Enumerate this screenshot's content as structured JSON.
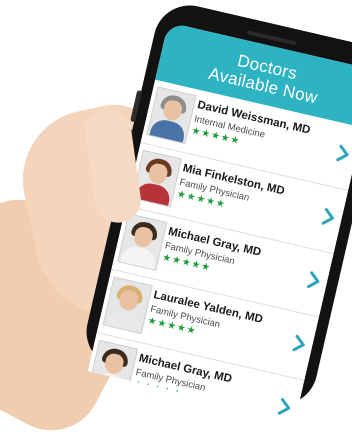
{
  "header": {
    "title_line1": "Doctors",
    "title_line2": "Available Now"
  },
  "doctors": [
    {
      "name": "David Weissman, MD",
      "specialty": "Internal Medicine",
      "stars": "★★★★★",
      "hair": "#8d8d8d",
      "shirt": "#4a74a8"
    },
    {
      "name": "Mia Finkelston, MD",
      "specialty": "Family Physician",
      "stars": "★★★★★",
      "hair": "#6b3a20",
      "shirt": "#b8323a"
    },
    {
      "name": "Michael Gray, MD",
      "specialty": "Family Physician",
      "stars": "★★★★★",
      "hair": "#3b2a1e",
      "shirt": "#f4f4f4"
    },
    {
      "name": "Lauralee Yalden, MD",
      "specialty": "Family Physician",
      "stars": "★★★★★",
      "hair": "#d8b073",
      "shirt": "#e9e9e9"
    },
    {
      "name": "Michael Gray, MD",
      "specialty": "Family Physician",
      "stars": "★★★★★",
      "hair": "#3b2a1e",
      "shirt": "#f4f4f4"
    }
  ],
  "colors": {
    "header_bg": "#2eb3c3",
    "star": "#1e9b3a",
    "chevron": "#2aa6b8"
  }
}
